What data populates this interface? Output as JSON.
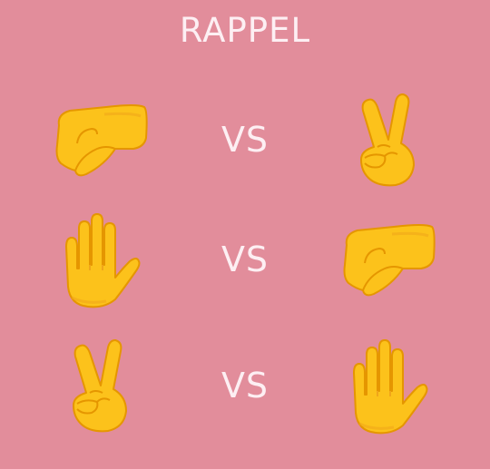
{
  "title": "RAPPEL",
  "colors": {
    "background": "#e28d9b",
    "text": "#fdeff3",
    "hand_fill": "#fcc21b",
    "hand_shade": "#f0a61a",
    "hand_outline": "#e59600"
  },
  "rounds": [
    {
      "left": "fist-icon",
      "vs": "VS",
      "right": "victory-icon"
    },
    {
      "left": "palm-icon",
      "vs": "VS",
      "right": "fist-icon"
    },
    {
      "left": "victory-icon",
      "vs": "VS",
      "right": "palm-icon"
    }
  ]
}
